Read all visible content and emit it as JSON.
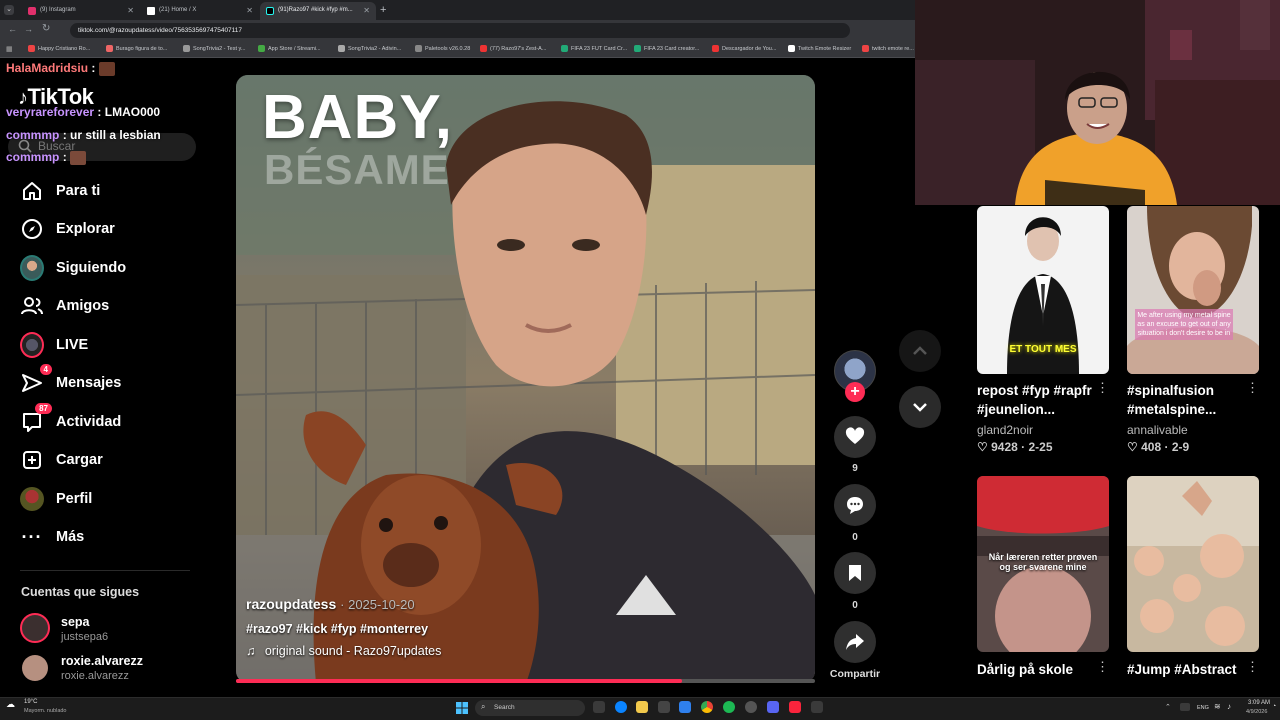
{
  "browser": {
    "tabs": [
      {
        "label": "(9) Instagram",
        "fav": "#e1306c"
      },
      {
        "label": "(21) Home / X",
        "fav": "#ffffff"
      },
      {
        "label": "(91)Razo97 #kick #fyp #m...",
        "fav": "#25f4ee"
      }
    ],
    "url": "tiktok.com/@razoupdatess/video/7563535697475407117",
    "bookmarks": [
      "Happy Cristiano Ro...",
      "Burago figura de to...",
      "SongTrivia2 - Test y...",
      "App Store / Streami...",
      "SongTrivia2 - Adivin...",
      "Paletools v26.0.28",
      "(77) Razo97's Zest-A...",
      "FIFA 23 FUT Card Cr...",
      "FIFA 23 Card creator...",
      "Descargador de You...",
      "Twitch Emote Resizer",
      "twitch emote re..."
    ]
  },
  "chat": [
    {
      "user": "HalaMadridsiu",
      "text": ":",
      "color": "#ff7a7a"
    },
    {
      "user": "veryrareforever",
      "text": ": LMAO000",
      "color": "#c894ff"
    },
    {
      "user": "commmp",
      "text": ": ur still a lesbian",
      "color": "#c894ff"
    },
    {
      "user": "commmp",
      "text": ":",
      "color": "#c894ff"
    }
  ],
  "sidebar": {
    "logo": "TikTok",
    "search_placeholder": "Buscar",
    "items": [
      {
        "label": "Para ti",
        "icon": "home-icon"
      },
      {
        "label": "Explorar",
        "icon": "compass-icon"
      },
      {
        "label": "Siguiendo",
        "icon": "following-avatar-icon"
      },
      {
        "label": "Amigos",
        "icon": "friends-icon"
      },
      {
        "label": "LIVE",
        "icon": "live-icon"
      },
      {
        "label": "Mensajes",
        "icon": "send-icon",
        "badge": "4"
      },
      {
        "label": "Actividad",
        "icon": "activity-icon",
        "badge": "87"
      },
      {
        "label": "Cargar",
        "icon": "upload-icon"
      },
      {
        "label": "Perfil",
        "icon": "profile-avatar-icon"
      },
      {
        "label": "Más",
        "icon": "more-icon"
      }
    ],
    "following_heading": "Cuentas que sigues",
    "following": [
      {
        "name": "sepa",
        "handle": "justsepa6"
      },
      {
        "name": "roxie.alvarezz",
        "handle": "roxie.alvarezz"
      }
    ]
  },
  "video": {
    "overlay_text_line1": "BABY,",
    "overlay_text_line2": "BÉSAME",
    "author": "razoupdatess",
    "date": "2025-10-20",
    "hashtags": "#razo97 #kick #fyp #monterrey",
    "sound": "original sound - Razo97updates",
    "progress": 0.77
  },
  "actions": {
    "likes": "9",
    "comments": "0",
    "saves": "0",
    "share": "Compartir"
  },
  "feed": [
    {
      "title": "repost #fyp #rapfr #jeunelion...",
      "author": "gland2noir",
      "likes": "9428",
      "date": "2-25",
      "overlay": "ET TOUT MES"
    },
    {
      "title": "#spinalfusion #metalspine...",
      "author": "annalivable",
      "likes": "408",
      "date": "2-9",
      "overlay": "Me after using my metal spine as an excuse to get out of any situation i don't desire to be in"
    },
    {
      "title": "Dårlig på skole",
      "author": "",
      "likes": "",
      "date": "",
      "overlay": "Når læreren retter prøven og ser svarene mine"
    },
    {
      "title": "#Jump #Abstract",
      "author": "",
      "likes": "",
      "date": "",
      "overlay": ""
    }
  ],
  "taskbar": {
    "weather_temp": "19°C",
    "weather_desc": "Mayorm. nublado",
    "search": "Search",
    "lang": "ENG",
    "time": "3:09 AM",
    "date": "4/9/2026"
  }
}
